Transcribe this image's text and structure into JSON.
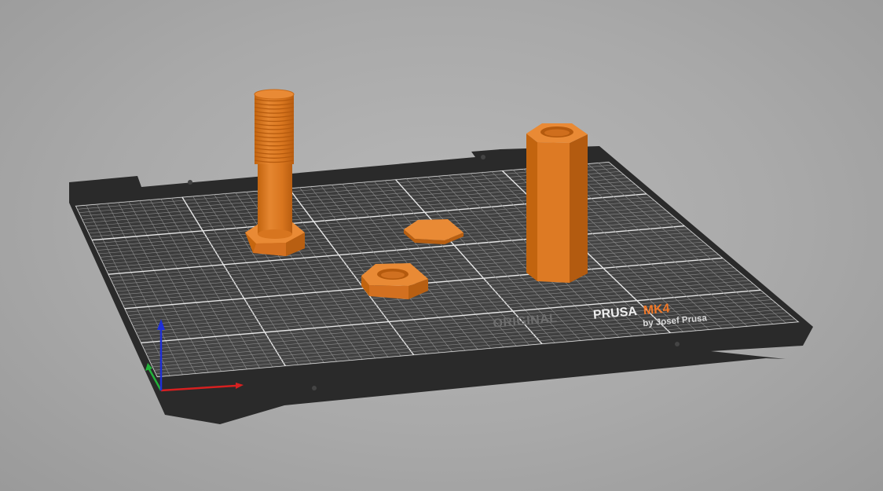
{
  "app": {
    "view": "3D plater"
  },
  "bed": {
    "brand_original": "ORIGINAL",
    "brand_prusa": "PRUSA",
    "brand_model": "MK4",
    "brand_byline": "by Josef Prusa"
  },
  "objects": [
    {
      "name": "bolt"
    },
    {
      "name": "hex nut flat"
    },
    {
      "name": "hex nut"
    },
    {
      "name": "hex standoff"
    }
  ],
  "colors": {
    "background": "#a9a9a9",
    "bed_frame": "#2b2b2b",
    "bed_sheet": "#3a3a3a",
    "grid_minor": "#8d8d8d",
    "grid_major": "#e6e6e6",
    "object_light": "#e98a35",
    "object_mid": "#d8731c",
    "object_dark": "#b85f12",
    "axis_x": "#d62020",
    "axis_y": "#22b33a",
    "axis_z": "#1f2fd6",
    "brand_accent": "#f07828"
  }
}
